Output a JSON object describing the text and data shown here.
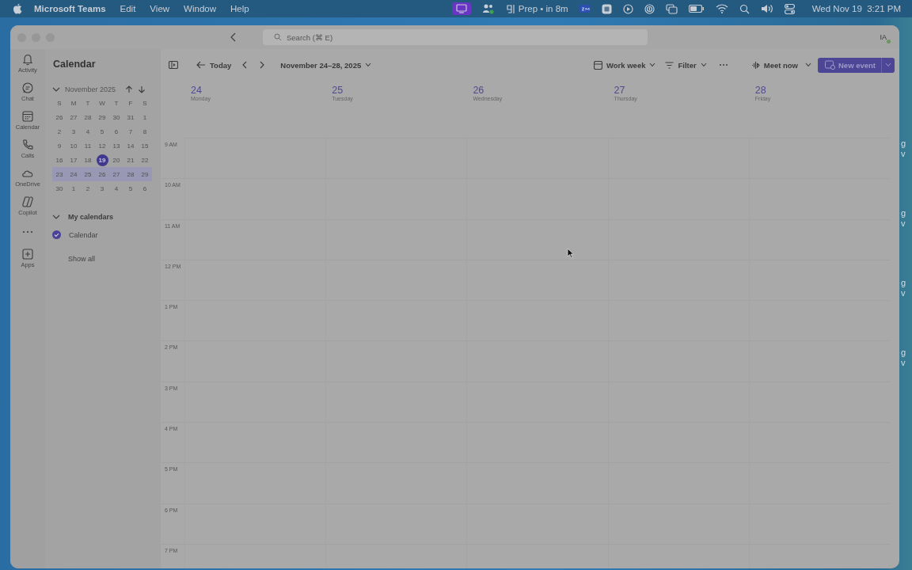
{
  "menu_bar": {
    "app": "Microsoft Teams",
    "menus": [
      "Edit",
      "View",
      "Window",
      "Help"
    ],
    "status_text": "Prep • in 8m",
    "clock": "Wed Nov 19  3:21 PM"
  },
  "desktop_labels": [
    {
      "lines": [
        "g",
        "v"
      ]
    },
    {
      "lines": [
        "g",
        "v"
      ]
    },
    {
      "lines": [
        "g",
        "v"
      ]
    },
    {
      "lines": [
        "g",
        "v"
      ]
    }
  ],
  "window": {
    "search": {
      "placeholder": "Search (⌘ E)"
    },
    "avatar": "IA"
  },
  "rail": [
    {
      "kind": "bell",
      "label": "Activity"
    },
    {
      "kind": "chat",
      "label": "Chat"
    },
    {
      "kind": "calendar",
      "label": "Calendar"
    },
    {
      "kind": "phone",
      "label": "Calls"
    },
    {
      "kind": "cloud",
      "label": "OneDrive"
    },
    {
      "kind": "copilot",
      "label": "Copilot"
    },
    {
      "kind": "more"
    },
    {
      "kind": "apps",
      "label": "Apps"
    }
  ],
  "sidebar": {
    "title": "Calendar",
    "mini_calendar": {
      "month": "November 2025",
      "weekdays": [
        "S",
        "M",
        "T",
        "W",
        "T",
        "F",
        "S"
      ],
      "weeks": [
        {
          "selected": false,
          "days": [
            {
              "d": "26",
              "today": false
            },
            {
              "d": "27",
              "today": false
            },
            {
              "d": "28",
              "today": false
            },
            {
              "d": "29",
              "today": false
            },
            {
              "d": "30",
              "today": false
            },
            {
              "d": "31",
              "today": false
            },
            {
              "d": "1",
              "today": false
            }
          ]
        },
        {
          "selected": false,
          "days": [
            {
              "d": "2",
              "today": false
            },
            {
              "d": "3",
              "today": false
            },
            {
              "d": "4",
              "today": false
            },
            {
              "d": "5",
              "today": false
            },
            {
              "d": "6",
              "today": false
            },
            {
              "d": "7",
              "today": false
            },
            {
              "d": "8",
              "today": false
            }
          ]
        },
        {
          "selected": false,
          "days": [
            {
              "d": "9",
              "today": false
            },
            {
              "d": "10",
              "today": false
            },
            {
              "d": "11",
              "today": false
            },
            {
              "d": "12",
              "today": false
            },
            {
              "d": "13",
              "today": false
            },
            {
              "d": "14",
              "today": false
            },
            {
              "d": "15",
              "today": false
            }
          ]
        },
        {
          "selected": false,
          "days": [
            {
              "d": "16",
              "today": false
            },
            {
              "d": "17",
              "today": false
            },
            {
              "d": "18",
              "today": false
            },
            {
              "d": "19",
              "today": true
            },
            {
              "d": "20",
              "today": false
            },
            {
              "d": "21",
              "today": false
            },
            {
              "d": "22",
              "today": false
            }
          ]
        },
        {
          "selected": true,
          "days": [
            {
              "d": "23",
              "today": false
            },
            {
              "d": "24",
              "today": false
            },
            {
              "d": "25",
              "today": false
            },
            {
              "d": "26",
              "today": false
            },
            {
              "d": "27",
              "today": false
            },
            {
              "d": "28",
              "today": false
            },
            {
              "d": "29",
              "today": false
            }
          ]
        },
        {
          "selected": false,
          "days": [
            {
              "d": "30",
              "today": false
            },
            {
              "d": "1",
              "today": false
            },
            {
              "d": "2",
              "today": false
            },
            {
              "d": "3",
              "today": false
            },
            {
              "d": "4",
              "today": false
            },
            {
              "d": "5",
              "today": false
            },
            {
              "d": "6",
              "today": false
            }
          ]
        }
      ]
    },
    "my_calendars": {
      "title": "My calendars",
      "expanded": true,
      "items": [
        {
          "label": "Calendar",
          "checked": true,
          "color": "#4b4298"
        }
      ]
    },
    "show_all": "Show all"
  },
  "toolbar": {
    "today": "Today",
    "range": "November 24–28, 2025",
    "view": "Work week",
    "filter": "Filter",
    "meet_now": "Meet now",
    "new_event": "New event"
  },
  "days": [
    {
      "number": "24",
      "weekday": "Monday"
    },
    {
      "number": "25",
      "weekday": "Tuesday"
    },
    {
      "number": "26",
      "weekday": "Wednesday"
    },
    {
      "number": "27",
      "weekday": "Thursday"
    },
    {
      "number": "28",
      "weekday": "Friday"
    }
  ],
  "hours": [
    "9 AM",
    "10 AM",
    "11 AM",
    "12 PM",
    "1 PM",
    "2 PM",
    "3 PM",
    "4 PM",
    "5 PM",
    "6 PM",
    "7 PM"
  ]
}
